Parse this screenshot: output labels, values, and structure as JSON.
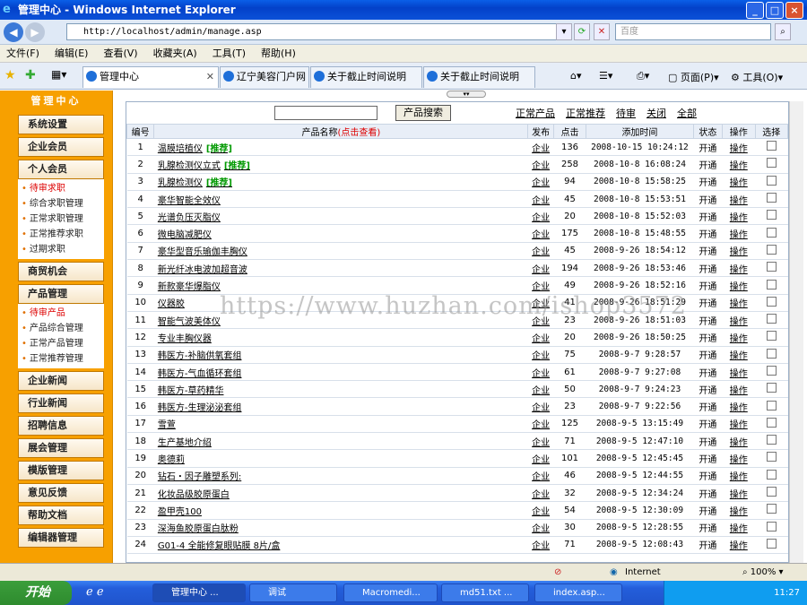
{
  "window": {
    "title": "管理中心 - Windows Internet Explorer"
  },
  "address": {
    "url": "http://localhost/admin/manage.asp",
    "search_placeholder": "百度"
  },
  "menu": [
    "文件(F)",
    "编辑(E)",
    "查看(V)",
    "收藏夹(A)",
    "工具(T)",
    "帮助(H)"
  ],
  "tabs": [
    {
      "label": "管理中心"
    },
    {
      "label": "辽宁美容门户网 -..."
    },
    {
      "label": "关于截止时间说明"
    },
    {
      "label": "关于截止时间说明"
    }
  ],
  "toolbar_right": {
    "page": "页面(P)",
    "tools": "工具(O)"
  },
  "sidebar": {
    "title": "管理中心",
    "sections": [
      {
        "label": "系统设置",
        "items": []
      },
      {
        "label": "企业会员",
        "items": []
      },
      {
        "label": "个人会员",
        "items": [
          "待审求职",
          "综合求职管理",
          "正常求职管理",
          "正常推荐求职",
          "过期求职"
        ]
      },
      {
        "label": "商贸机会",
        "items": []
      },
      {
        "label": "产品管理",
        "items": [
          "待审产品",
          "产品综合管理",
          "正常产品管理",
          "正常推荐管理"
        ]
      },
      {
        "label": "企业新闻",
        "items": []
      },
      {
        "label": "行业新闻",
        "items": []
      },
      {
        "label": "招聘信息",
        "items": []
      },
      {
        "label": "展会管理",
        "items": []
      },
      {
        "label": "模版管理",
        "items": []
      },
      {
        "label": "意见反馈",
        "items": []
      },
      {
        "label": "帮助文档",
        "items": []
      },
      {
        "label": "编辑器管理",
        "items": []
      }
    ]
  },
  "main": {
    "search_button": "产品搜索",
    "filters": [
      "正常产品",
      "正常推荐",
      "待审",
      "关闭",
      "全部"
    ],
    "columns": {
      "num": "编号",
      "name": "产品名称",
      "name_hint": "(点击查看)",
      "pub": "发布",
      "clicks": "点击",
      "time": "添加时间",
      "status": "状态",
      "op": "操作",
      "select": "选择"
    },
    "rows": [
      {
        "num": "1",
        "name": "温膜培植仪",
        "tag": "[推荐]",
        "pub": "企业",
        "clicks": "136",
        "time": "2008-10-15 10:24:12",
        "status": "开通",
        "op": "操作"
      },
      {
        "num": "2",
        "name": "乳腺检测仪立式",
        "tag": "[推荐]",
        "pub": "企业",
        "clicks": "258",
        "time": "2008-10-8 16:08:24",
        "status": "开通",
        "op": "操作"
      },
      {
        "num": "3",
        "name": "乳腺检测仪",
        "tag": "[推荐]",
        "pub": "企业",
        "clicks": "94",
        "time": "2008-10-8 15:58:25",
        "status": "开通",
        "op": "操作"
      },
      {
        "num": "4",
        "name": "豪华智能全效仪",
        "tag": "",
        "pub": "企业",
        "clicks": "45",
        "time": "2008-10-8 15:53:51",
        "status": "开通",
        "op": "操作"
      },
      {
        "num": "5",
        "name": "光谱负压灭脂仪",
        "tag": "",
        "pub": "企业",
        "clicks": "20",
        "time": "2008-10-8 15:52:03",
        "status": "开通",
        "op": "操作"
      },
      {
        "num": "6",
        "name": "微电脑减肥仪",
        "tag": "",
        "pub": "企业",
        "clicks": "175",
        "time": "2008-10-8 15:48:55",
        "status": "开通",
        "op": "操作"
      },
      {
        "num": "7",
        "name": "豪华型音乐瑜伽丰胸仪",
        "tag": "",
        "pub": "企业",
        "clicks": "45",
        "time": "2008-9-26 18:54:12",
        "status": "开通",
        "op": "操作"
      },
      {
        "num": "8",
        "name": "新光纤冰电波加超音波",
        "tag": "",
        "pub": "企业",
        "clicks": "194",
        "time": "2008-9-26 18:53:46",
        "status": "开通",
        "op": "操作"
      },
      {
        "num": "9",
        "name": "新款豪华爆脂仪",
        "tag": "",
        "pub": "企业",
        "clicks": "49",
        "time": "2008-9-26 18:52:16",
        "status": "开通",
        "op": "操作"
      },
      {
        "num": "10",
        "name": "仪器胶",
        "tag": "",
        "pub": "企业",
        "clicks": "41",
        "time": "2008-9-26 18:51:29",
        "status": "开通",
        "op": "操作"
      },
      {
        "num": "11",
        "name": "智能气波美体仪",
        "tag": "",
        "pub": "企业",
        "clicks": "23",
        "time": "2008-9-26 18:51:03",
        "status": "开通",
        "op": "操作"
      },
      {
        "num": "12",
        "name": "专业丰胸仪器",
        "tag": "",
        "pub": "企业",
        "clicks": "20",
        "time": "2008-9-26 18:50:25",
        "status": "开通",
        "op": "操作"
      },
      {
        "num": "13",
        "name": "韩医方-补脑供氧套组",
        "tag": "",
        "pub": "企业",
        "clicks": "75",
        "time": "2008-9-7 9:28:57",
        "status": "开通",
        "op": "操作"
      },
      {
        "num": "14",
        "name": "韩医方-气血循环套组",
        "tag": "",
        "pub": "企业",
        "clicks": "61",
        "time": "2008-9-7 9:27:08",
        "status": "开通",
        "op": "操作"
      },
      {
        "num": "15",
        "name": "韩医方-草药精华",
        "tag": "",
        "pub": "企业",
        "clicks": "50",
        "time": "2008-9-7 9:24:23",
        "status": "开通",
        "op": "操作"
      },
      {
        "num": "16",
        "name": "韩医方-生理泌泌套组",
        "tag": "",
        "pub": "企业",
        "clicks": "23",
        "time": "2008-9-7 9:22:56",
        "status": "开通",
        "op": "操作"
      },
      {
        "num": "17",
        "name": "雪萱",
        "tag": "",
        "pub": "企业",
        "clicks": "125",
        "time": "2008-9-5 13:15:49",
        "status": "开通",
        "op": "操作"
      },
      {
        "num": "18",
        "name": "生产基地介绍",
        "tag": "",
        "pub": "企业",
        "clicks": "71",
        "time": "2008-9-5 12:47:10",
        "status": "开通",
        "op": "操作"
      },
      {
        "num": "19",
        "name": "奥德莉",
        "tag": "",
        "pub": "企业",
        "clicks": "101",
        "time": "2008-9-5 12:45:45",
        "status": "开通",
        "op": "操作"
      },
      {
        "num": "20",
        "name": "钻石・因子雕塑系列:",
        "tag": "",
        "pub": "企业",
        "clicks": "46",
        "time": "2008-9-5 12:44:55",
        "status": "开通",
        "op": "操作"
      },
      {
        "num": "21",
        "name": "化妆品级胶原蛋白",
        "tag": "",
        "pub": "企业",
        "clicks": "32",
        "time": "2008-9-5 12:34:24",
        "status": "开通",
        "op": "操作"
      },
      {
        "num": "22",
        "name": "盈甲壳100",
        "tag": "",
        "pub": "企业",
        "clicks": "54",
        "time": "2008-9-5 12:30:09",
        "status": "开通",
        "op": "操作"
      },
      {
        "num": "23",
        "name": "深海鱼胶原蛋白肽粉",
        "tag": "",
        "pub": "企业",
        "clicks": "30",
        "time": "2008-9-5 12:28:55",
        "status": "开通",
        "op": "操作"
      },
      {
        "num": "24",
        "name": "G01-4   全能修复眼贴膜   8片/盒",
        "tag": "",
        "pub": "企业",
        "clicks": "71",
        "time": "2008-9-5 12:08:43",
        "status": "开通",
        "op": "操作"
      }
    ]
  },
  "watermark": "https://www.huzhan.com/ishop3572",
  "status": {
    "zone": "Internet",
    "zoom": "100%"
  },
  "taskbar": {
    "start": "开始",
    "tasks": [
      "管理中心 ...",
      "调试",
      "Macromedi...",
      "md51.txt ...",
      "index.asp..."
    ],
    "clock": "11:27"
  }
}
